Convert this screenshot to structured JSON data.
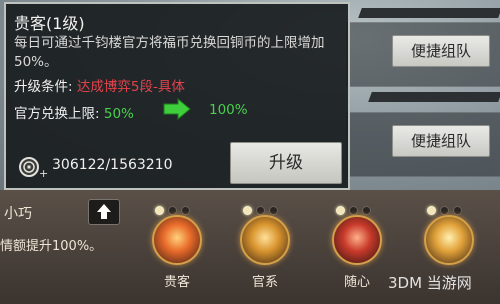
{
  "tooltip": {
    "title": "贵客(1级)",
    "description": "每日可通过千钧楼官方将福币兑换回铜币的上限增加50%。",
    "condition_label": "升级条件:",
    "condition_value": "达成博弈5段-具体",
    "limit_label": "官方兑换上限:",
    "limit_from": "50%",
    "limit_to": "100%",
    "coins": "306122/1563210",
    "upgrade_label": "升级",
    "arrow_icon": "green-arrow-right-icon",
    "coin_icon": "coin-icon"
  },
  "team_buttons": [
    "便捷组队",
    "便捷组队"
  ],
  "player": {
    "name": "小巧",
    "bottom_text": "情额提升100%。"
  },
  "skills": [
    {
      "label": "贵客",
      "dots": [
        true,
        false,
        false
      ],
      "color": "#e86a2a"
    },
    {
      "label": "官系",
      "dots": [
        true,
        false,
        false
      ],
      "color": "#d8942e"
    },
    {
      "label": "随心",
      "dots": [
        true,
        false,
        false
      ],
      "color": "#c83a2a"
    },
    {
      "label": "",
      "dots": [
        true,
        false,
        false
      ],
      "color": "#e2a23a"
    }
  ],
  "watermark": "3DM 当游网"
}
